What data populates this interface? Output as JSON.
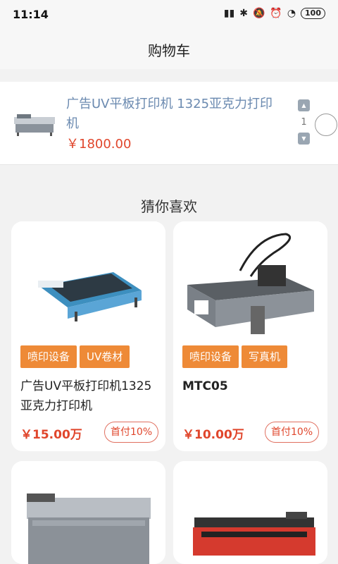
{
  "status_bar": {
    "time": "11:14",
    "battery": "100"
  },
  "header": {
    "title": "购物车"
  },
  "cart": {
    "item": {
      "name": "广告UV平板打印机 1325亚克力打印机",
      "price": "￥1800.00",
      "quantity": "1"
    }
  },
  "recommend": {
    "title": "猜你喜欢",
    "products": [
      {
        "tags": [
          "喷印设备",
          "UV卷材"
        ],
        "title": "广告UV平板打印机1325亚克力打印机",
        "price": "￥15.00万",
        "payment": "首付10%"
      },
      {
        "tags": [
          "喷印设备",
          "写真机"
        ],
        "title": "MTC05",
        "price": "￥10.00万",
        "payment": "首付10%"
      }
    ]
  },
  "colors": {
    "accent": "#ee8a37",
    "price": "#e0462c",
    "link": "#6b8ab0"
  }
}
